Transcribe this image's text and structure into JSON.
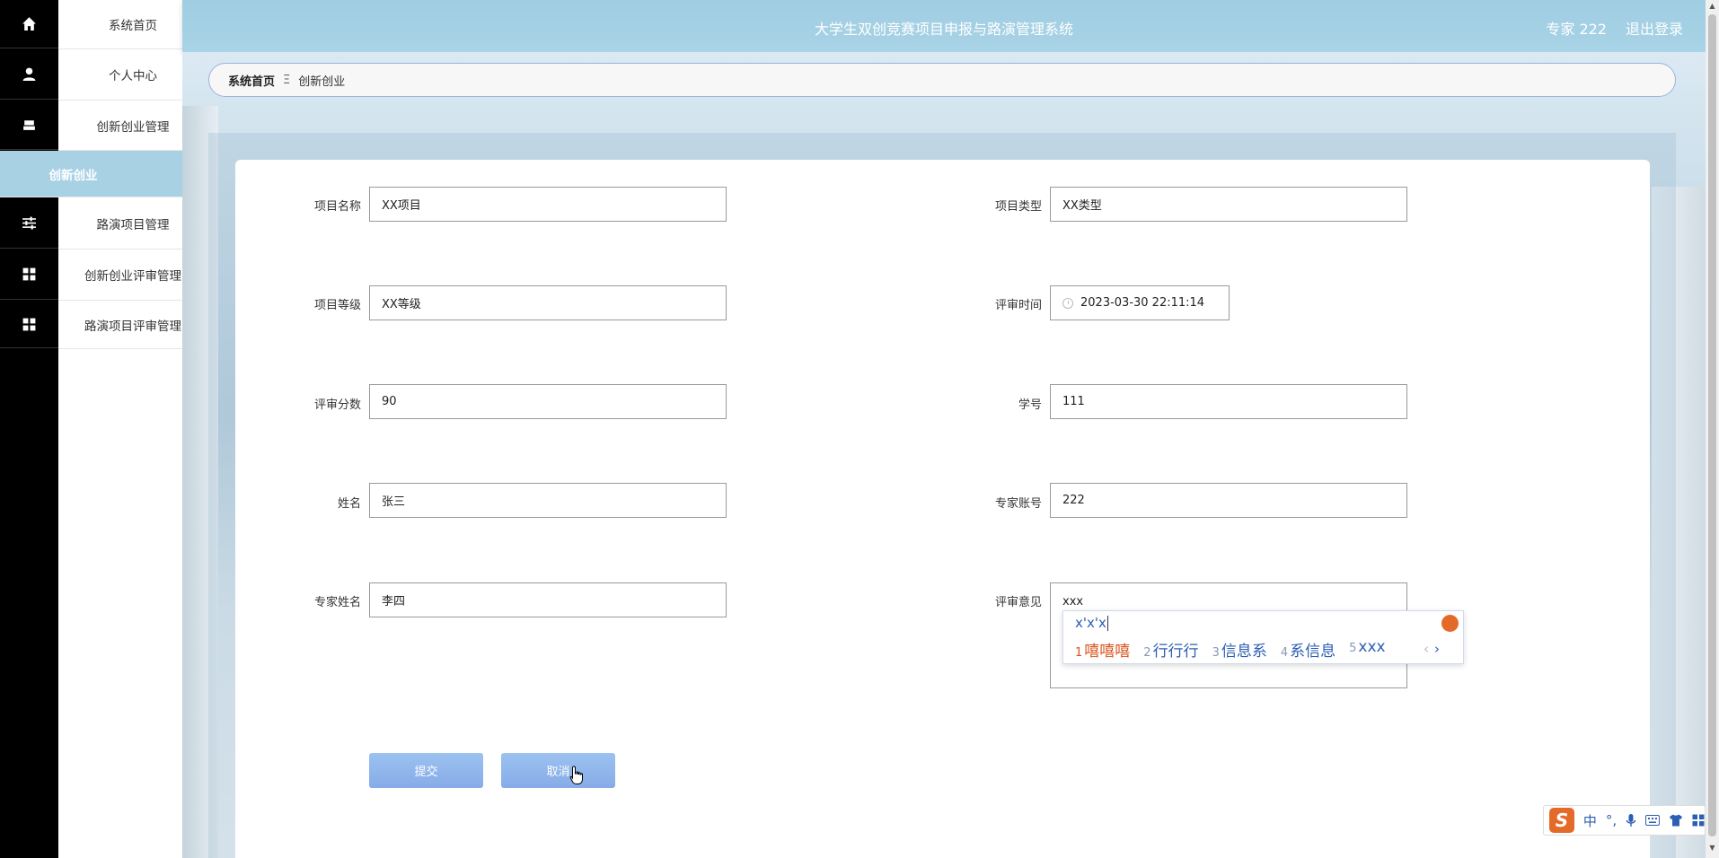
{
  "header": {
    "title": "大学生双创竞赛项目申报与路演管理系统",
    "user": "专家 222",
    "logout": "退出登录"
  },
  "sidebar": {
    "items": [
      {
        "label": "系统首页",
        "icon": "home-icon"
      },
      {
        "label": "个人中心",
        "icon": "user-icon"
      },
      {
        "label": "创新创业管理",
        "icon": "folder-icon"
      },
      {
        "label": "创新创业",
        "icon": "",
        "active": true
      },
      {
        "label": "路演项目管理",
        "icon": "sliders-icon"
      },
      {
        "label": "创新创业评审管理",
        "icon": "grid-icon"
      },
      {
        "label": "路演项目评审管理",
        "icon": "grid-icon"
      }
    ]
  },
  "breadcrumb": {
    "home": "系统首页",
    "separator": "Ξ",
    "current": "创新创业"
  },
  "form": {
    "project_name": {
      "label": "项目名称",
      "value": "XX项目"
    },
    "project_type": {
      "label": "项目类型",
      "value": "XX类型"
    },
    "project_level": {
      "label": "项目等级",
      "value": "XX等级"
    },
    "review_time": {
      "label": "评审时间",
      "value": "2023-03-30 22:11:14"
    },
    "review_score": {
      "label": "评审分数",
      "value": "90"
    },
    "student_id": {
      "label": "学号",
      "value": "111"
    },
    "name": {
      "label": "姓名",
      "value": "张三"
    },
    "expert_account": {
      "label": "专家账号",
      "value": "222"
    },
    "expert_name": {
      "label": "专家姓名",
      "value": "李四"
    },
    "review_opinion": {
      "label": "评审意见",
      "value": "xxx"
    }
  },
  "ime_popup": {
    "pinyin": "x'x'x",
    "candidates": [
      {
        "num": "1",
        "text": "嘻嘻嘻"
      },
      {
        "num": "2",
        "text": "行行行"
      },
      {
        "num": "3",
        "text": "信息系"
      },
      {
        "num": "4",
        "text": "系信息"
      },
      {
        "num": "5",
        "text": "xxx"
      }
    ],
    "prev": "‹",
    "next": "›"
  },
  "buttons": {
    "submit": "提交",
    "cancel": "取消"
  },
  "ime_toolbar": {
    "logo": "S",
    "mode": "中",
    "punct": "°,"
  },
  "colors": {
    "header": "#a8d2e4",
    "active_menu": "#a8d2e4",
    "button": "#8fb5ec",
    "rail": "#000000"
  }
}
